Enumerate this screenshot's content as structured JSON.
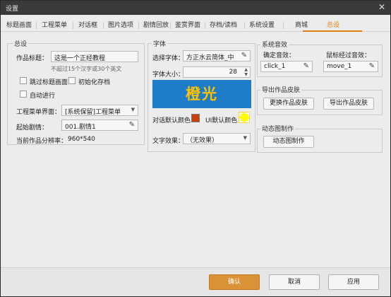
{
  "window": {
    "title": "设置",
    "close_symbol": "✕"
  },
  "tabs": [
    {
      "label": "标题画面"
    },
    {
      "label": "工程菜单"
    },
    {
      "label": "对话框"
    },
    {
      "label": "图片选项"
    },
    {
      "label": "剧情回放"
    },
    {
      "label": "鉴赏界面"
    },
    {
      "label": "存档/读档"
    },
    {
      "label": "系统设置"
    },
    {
      "label": "商城"
    },
    {
      "label": "总设"
    }
  ],
  "active_tab": "总设",
  "colors": {
    "accent": "#e07d11",
    "preview_bg": "#1f7cc8",
    "preview_text": "#ffc200",
    "dialog_color": "#c8410a",
    "ui_color": "#ffff00"
  },
  "general": {
    "legend": "总设",
    "title_label": "作品标题：",
    "title_value": "这是一个正经教程",
    "title_hint": "不超过15个汉字或30个英文",
    "skip_title_label": "跳过标题画面",
    "init_save_label": "初始化存档",
    "auto_run_label": "自动进行",
    "menu_label": "工程菜单界面：",
    "menu_value": "[系统保留]工程菜单",
    "start_label": "起始剧情：",
    "start_value": "001.剧情1",
    "resolution_label": "当前作品分辨率：",
    "resolution_value": "960*540"
  },
  "font": {
    "legend": "字体",
    "select_label": "选择字体：",
    "select_value": "方正水云简体_中",
    "size_label": "字体大小：",
    "size_value": "28",
    "preview_text": "橙光",
    "dialog_color_label": "对话默认颜色：",
    "ui_color_label": "UI默认颜色：",
    "effect_label": "文字效果：",
    "effect_value": "（无效果）"
  },
  "sound": {
    "legend": "系统音效",
    "confirm_label": "确定音效：",
    "confirm_value": "click_1",
    "hover_label": "鼠标经过音效：",
    "hover_value": "move_1"
  },
  "skin": {
    "legend": "导出作品皮肤",
    "change_button": "更换作品皮肤",
    "export_button": "导出作品皮肤"
  },
  "animation": {
    "legend": "动态图制作",
    "make_button": "动态图制作"
  },
  "footer": {
    "ok": "确认",
    "cancel": "取消",
    "apply": "应用"
  }
}
